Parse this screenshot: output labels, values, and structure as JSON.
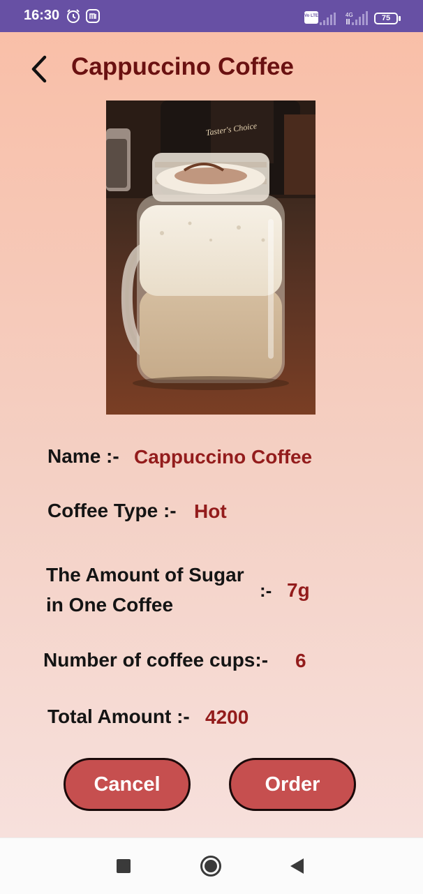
{
  "status_bar": {
    "time": "16:30",
    "network_label": "4G",
    "volte_label": "Vo LTE",
    "battery": "75",
    "icons": [
      "alarm-icon",
      "mi-icon",
      "volte-icon",
      "signal-icon",
      "battery-icon"
    ]
  },
  "header": {
    "title": "Cappuccino Coffee",
    "back_icon": "chevron-left-icon"
  },
  "image": {
    "jar_label": "Taster's Choice"
  },
  "details": {
    "name_label": "Name :-",
    "name_value": "Cappuccino Coffee",
    "type_label": "Coffee Type :-",
    "type_value": "Hot",
    "sugar_label_line1": "The Amount of Sugar",
    "sugar_label_line2": "in One Coffee",
    "sugar_separator": ":-",
    "sugar_value": "7g",
    "cups_label": "Number of coffee cups:-",
    "cups_value": "6",
    "total_label": "Total Amount :-",
    "total_value": "4200"
  },
  "actions": {
    "cancel_label": "Cancel",
    "order_label": "Order"
  },
  "colors": {
    "status_bar": "#6750a4",
    "title": "#6a1111",
    "value": "#931c1c",
    "button": "#c64f4f"
  },
  "nav": {
    "icons": [
      "square-icon",
      "circle-icon",
      "triangle-back-icon"
    ]
  }
}
